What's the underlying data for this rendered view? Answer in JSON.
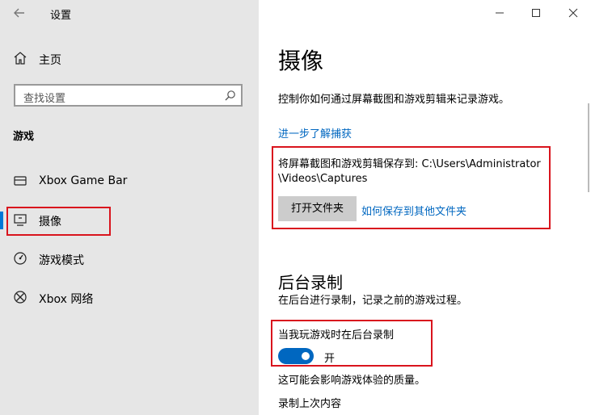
{
  "window": {
    "title": "设置",
    "buttons": {
      "minimize": "minimize-icon",
      "maximize": "maximize-icon",
      "close": "close-icon"
    }
  },
  "sidebar": {
    "home_label": "主页",
    "search_placeholder": "查找设置",
    "section_title": "游戏",
    "items": [
      {
        "label": "Xbox Game Bar",
        "icon": "xbox-game-bar-icon"
      },
      {
        "label": "摄像",
        "icon": "captures-icon",
        "active": true
      },
      {
        "label": "游戏模式",
        "icon": "game-mode-icon"
      },
      {
        "label": "Xbox 网络",
        "icon": "xbox-icon"
      }
    ]
  },
  "main": {
    "title": "摄像",
    "description": "控制你如何通过屏幕截图和游戏剪辑来记录游戏。",
    "learn_more": "进一步了解捕获",
    "save_path_text": "将屏幕截图和游戏剪辑保存到: C:\\Users\\Administrator\\Videos\\Captures",
    "open_folder_button": "打开文件夹",
    "save_other_link": "如何保存到其他文件夹",
    "background_recording": {
      "heading": "后台录制",
      "subtitle": "在后台进行录制，记录之前的游戏过程。",
      "toggle_label": "当我玩游戏时在后台录制",
      "toggle_state": "开",
      "toggle_on": true,
      "note": "这可能会影响游戏体验的质量。",
      "record_last": "录制上次内容"
    }
  },
  "colors": {
    "accent": "#0067c0",
    "highlight_box": "#d9141d",
    "sidebar_bg": "#e6e6e6"
  }
}
